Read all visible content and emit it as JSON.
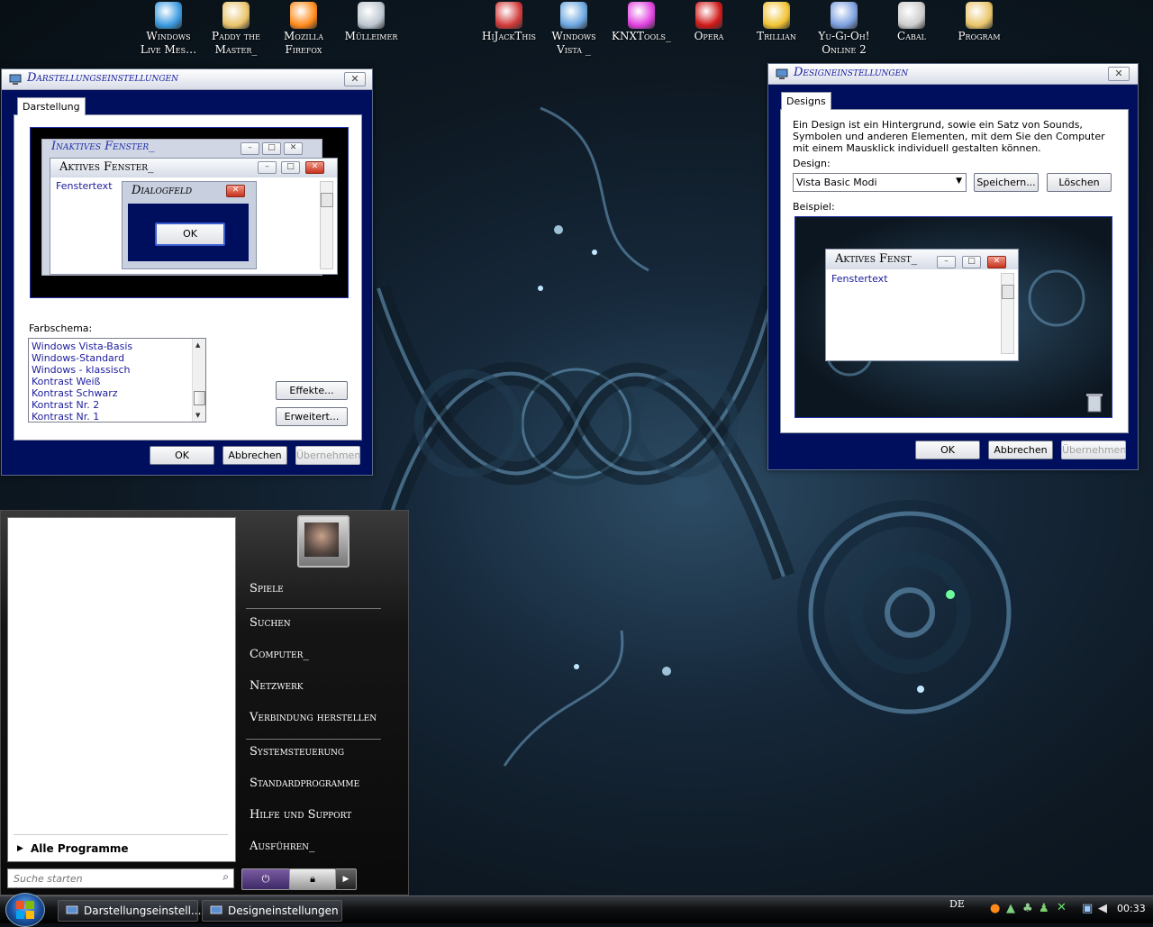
{
  "desktop_icons": [
    {
      "label": "Windows Live Mes…",
      "icon": "messenger-icon"
    },
    {
      "label": "Paddy the Master_",
      "icon": "folder-icon"
    },
    {
      "label": "Mozilla Firefox",
      "icon": "firefox-icon"
    },
    {
      "label": "Mülleimer",
      "icon": "recycle-bin-icon"
    },
    {
      "label": "HiJackThis",
      "icon": "hijackthis-icon"
    },
    {
      "label": "Windows Vista _",
      "icon": "vista-shortcut-icon"
    },
    {
      "label": "KNXTools_",
      "icon": "knxtools-icon"
    },
    {
      "label": "Opera",
      "icon": "opera-icon"
    },
    {
      "label": "Trillian",
      "icon": "trillian-icon"
    },
    {
      "label": "Yu-Gi-Oh! Online 2",
      "icon": "yugioh-icon"
    },
    {
      "label": "Cabal",
      "icon": "cabal-icon"
    },
    {
      "label": "Program",
      "icon": "folder-icon"
    }
  ],
  "appearance_window": {
    "title": "Darstellungseinstellungen",
    "tab": "Darstellung",
    "preview": {
      "inactive_title": "Inaktives Fenster_",
      "active_title": "Aktives Fenster_",
      "window_text": "Fenstertext",
      "dialog_title": "Dialogfeld",
      "dialog_ok": "OK"
    },
    "color_scheme_label": "Farbschema:",
    "color_schemes": [
      "Windows Vista-Basis",
      "Windows-Standard",
      "Windows - klassisch",
      "Kontrast Weiß",
      "Kontrast Schwarz",
      "Kontrast Nr. 2",
      "Kontrast Nr. 1"
    ],
    "effects_button": "Effekte...",
    "advanced_button": "Erweitert...",
    "ok": "OK",
    "cancel": "Abbrechen",
    "apply": "Übernehmen"
  },
  "design_window": {
    "title": "Designeinstellungen",
    "tab": "Designs",
    "description": "Ein Design ist ein Hintergrund, sowie ein Satz von Sounds, Symbolen und anderen Elementen, mit dem Sie den Computer mit einem Mausklick individuell gestalten können.",
    "design_label": "Design:",
    "design_value": "Vista Basic Modi",
    "save_button": "Speichern...",
    "delete_button": "Löschen",
    "example_label": "Beispiel:",
    "preview": {
      "active_title": "Aktives Fenst_",
      "window_text": "Fenstertext"
    },
    "ok": "OK",
    "cancel": "Abbrechen",
    "apply": "Übernehmen"
  },
  "start_menu": {
    "all_programs": "Alle Programme",
    "search_placeholder": "Suche starten",
    "right_items": [
      "Spiele",
      "Suchen",
      "Computer_",
      "Netzwerk",
      "Verbindung herstellen",
      "Systemsteuerung",
      "Standardprogramme",
      "Hilfe und Support",
      "Ausführen_"
    ]
  },
  "taskbar": {
    "buttons": [
      "Darstellungseinstell...",
      "Designeinstellungen"
    ],
    "language": "DE",
    "clock": "00:33"
  }
}
